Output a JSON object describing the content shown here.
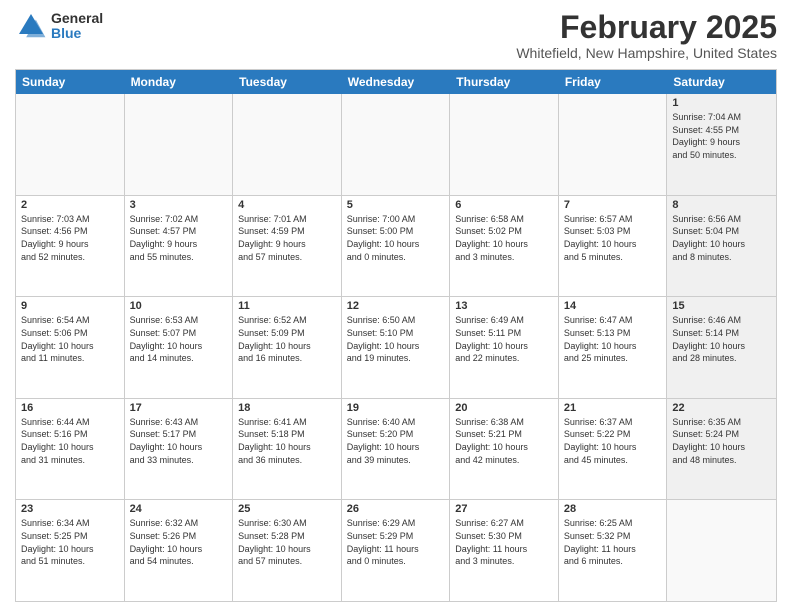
{
  "logo": {
    "general": "General",
    "blue": "Blue"
  },
  "title": {
    "main": "February 2025",
    "sub": "Whitefield, New Hampshire, United States"
  },
  "calendar": {
    "headers": [
      "Sunday",
      "Monday",
      "Tuesday",
      "Wednesday",
      "Thursday",
      "Friday",
      "Saturday"
    ],
    "rows": [
      [
        {
          "day": "",
          "info": "",
          "empty": true
        },
        {
          "day": "",
          "info": "",
          "empty": true
        },
        {
          "day": "",
          "info": "",
          "empty": true
        },
        {
          "day": "",
          "info": "",
          "empty": true
        },
        {
          "day": "",
          "info": "",
          "empty": true
        },
        {
          "day": "",
          "info": "",
          "empty": true
        },
        {
          "day": "1",
          "info": "Sunrise: 7:04 AM\nSunset: 4:55 PM\nDaylight: 9 hours\nand 50 minutes.",
          "empty": false,
          "shaded": true
        }
      ],
      [
        {
          "day": "2",
          "info": "Sunrise: 7:03 AM\nSunset: 4:56 PM\nDaylight: 9 hours\nand 52 minutes.",
          "empty": false
        },
        {
          "day": "3",
          "info": "Sunrise: 7:02 AM\nSunset: 4:57 PM\nDaylight: 9 hours\nand 55 minutes.",
          "empty": false
        },
        {
          "day": "4",
          "info": "Sunrise: 7:01 AM\nSunset: 4:59 PM\nDaylight: 9 hours\nand 57 minutes.",
          "empty": false
        },
        {
          "day": "5",
          "info": "Sunrise: 7:00 AM\nSunset: 5:00 PM\nDaylight: 10 hours\nand 0 minutes.",
          "empty": false
        },
        {
          "day": "6",
          "info": "Sunrise: 6:58 AM\nSunset: 5:02 PM\nDaylight: 10 hours\nand 3 minutes.",
          "empty": false
        },
        {
          "day": "7",
          "info": "Sunrise: 6:57 AM\nSunset: 5:03 PM\nDaylight: 10 hours\nand 5 minutes.",
          "empty": false
        },
        {
          "day": "8",
          "info": "Sunrise: 6:56 AM\nSunset: 5:04 PM\nDaylight: 10 hours\nand 8 minutes.",
          "empty": false,
          "shaded": true
        }
      ],
      [
        {
          "day": "9",
          "info": "Sunrise: 6:54 AM\nSunset: 5:06 PM\nDaylight: 10 hours\nand 11 minutes.",
          "empty": false
        },
        {
          "day": "10",
          "info": "Sunrise: 6:53 AM\nSunset: 5:07 PM\nDaylight: 10 hours\nand 14 minutes.",
          "empty": false
        },
        {
          "day": "11",
          "info": "Sunrise: 6:52 AM\nSunset: 5:09 PM\nDaylight: 10 hours\nand 16 minutes.",
          "empty": false
        },
        {
          "day": "12",
          "info": "Sunrise: 6:50 AM\nSunset: 5:10 PM\nDaylight: 10 hours\nand 19 minutes.",
          "empty": false
        },
        {
          "day": "13",
          "info": "Sunrise: 6:49 AM\nSunset: 5:11 PM\nDaylight: 10 hours\nand 22 minutes.",
          "empty": false
        },
        {
          "day": "14",
          "info": "Sunrise: 6:47 AM\nSunset: 5:13 PM\nDaylight: 10 hours\nand 25 minutes.",
          "empty": false
        },
        {
          "day": "15",
          "info": "Sunrise: 6:46 AM\nSunset: 5:14 PM\nDaylight: 10 hours\nand 28 minutes.",
          "empty": false,
          "shaded": true
        }
      ],
      [
        {
          "day": "16",
          "info": "Sunrise: 6:44 AM\nSunset: 5:16 PM\nDaylight: 10 hours\nand 31 minutes.",
          "empty": false
        },
        {
          "day": "17",
          "info": "Sunrise: 6:43 AM\nSunset: 5:17 PM\nDaylight: 10 hours\nand 33 minutes.",
          "empty": false
        },
        {
          "day": "18",
          "info": "Sunrise: 6:41 AM\nSunset: 5:18 PM\nDaylight: 10 hours\nand 36 minutes.",
          "empty": false
        },
        {
          "day": "19",
          "info": "Sunrise: 6:40 AM\nSunset: 5:20 PM\nDaylight: 10 hours\nand 39 minutes.",
          "empty": false
        },
        {
          "day": "20",
          "info": "Sunrise: 6:38 AM\nSunset: 5:21 PM\nDaylight: 10 hours\nand 42 minutes.",
          "empty": false
        },
        {
          "day": "21",
          "info": "Sunrise: 6:37 AM\nSunset: 5:22 PM\nDaylight: 10 hours\nand 45 minutes.",
          "empty": false
        },
        {
          "day": "22",
          "info": "Sunrise: 6:35 AM\nSunset: 5:24 PM\nDaylight: 10 hours\nand 48 minutes.",
          "empty": false,
          "shaded": true
        }
      ],
      [
        {
          "day": "23",
          "info": "Sunrise: 6:34 AM\nSunset: 5:25 PM\nDaylight: 10 hours\nand 51 minutes.",
          "empty": false
        },
        {
          "day": "24",
          "info": "Sunrise: 6:32 AM\nSunset: 5:26 PM\nDaylight: 10 hours\nand 54 minutes.",
          "empty": false
        },
        {
          "day": "25",
          "info": "Sunrise: 6:30 AM\nSunset: 5:28 PM\nDaylight: 10 hours\nand 57 minutes.",
          "empty": false
        },
        {
          "day": "26",
          "info": "Sunrise: 6:29 AM\nSunset: 5:29 PM\nDaylight: 11 hours\nand 0 minutes.",
          "empty": false
        },
        {
          "day": "27",
          "info": "Sunrise: 6:27 AM\nSunset: 5:30 PM\nDaylight: 11 hours\nand 3 minutes.",
          "empty": false
        },
        {
          "day": "28",
          "info": "Sunrise: 6:25 AM\nSunset: 5:32 PM\nDaylight: 11 hours\nand 6 minutes.",
          "empty": false
        },
        {
          "day": "",
          "info": "",
          "empty": true
        }
      ]
    ]
  }
}
